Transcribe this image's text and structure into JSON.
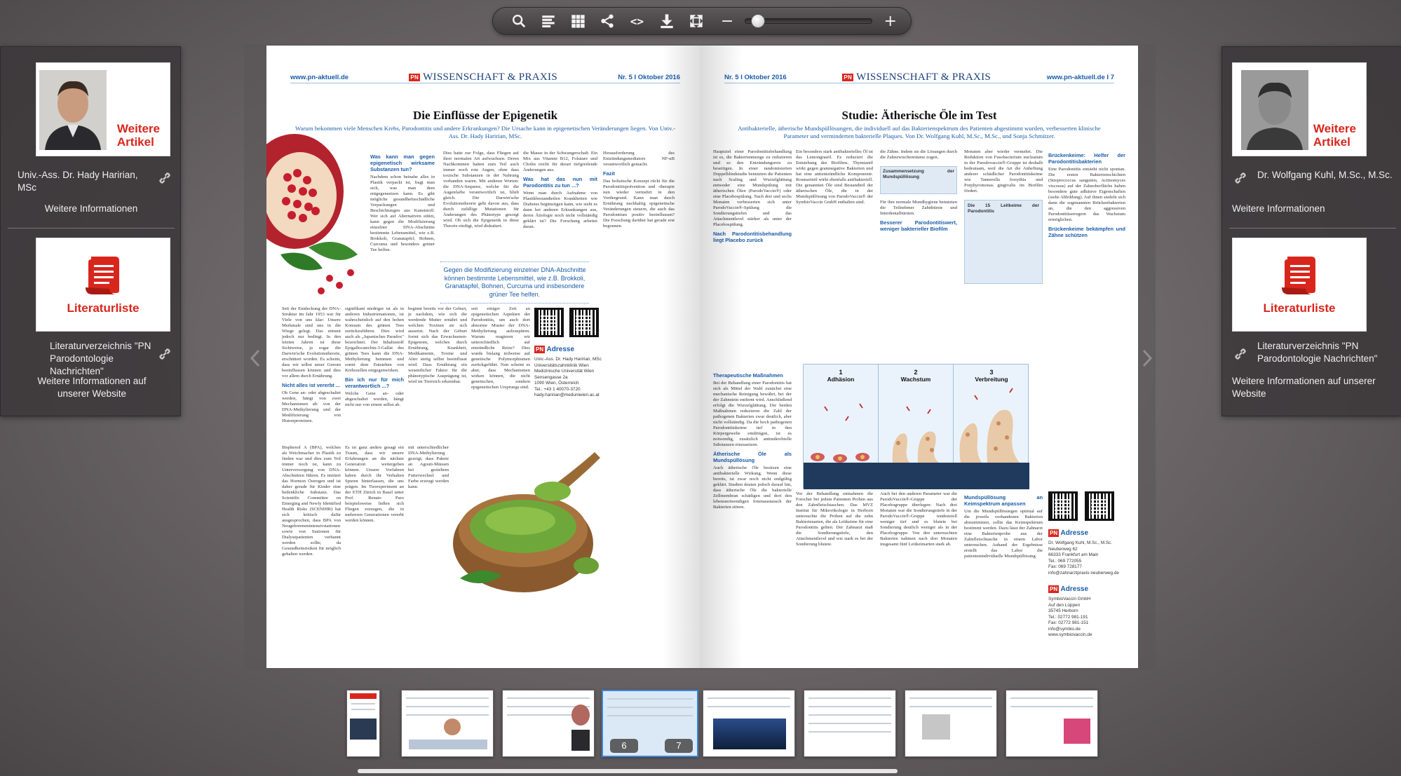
{
  "toolbar": {
    "icons": [
      "search-icon",
      "text-list-icon",
      "grid-icon",
      "share-icon",
      "code-icon",
      "download-icon",
      "fullscreen-icon"
    ],
    "code_glyph": "<>",
    "zoom_minus": "−",
    "zoom_plus": "+",
    "zoom_level": 0.05
  },
  "left_panel": {
    "author_card_label": "Weitere\nArtikel",
    "author_name": "Univ.-Ass. Dr. Hady Haririan, MSc",
    "author_more": "Weitere Informationen",
    "literature_label": "Literaturliste",
    "literature_name": "Literaturverzeichnis \"PN Parodontologie Nachrichten\"",
    "literature_more": "Weitere Informationen auf unserer Website"
  },
  "right_panel": {
    "author_card_label": "Weitere\nArtikel",
    "author_name": "Dr. Wolfgang Kuhl, M.Sc., M.Sc.",
    "author_more": "Weitere Informationen",
    "literature_label": "Literaturliste",
    "literature_name": "Literaturverzeichnis \"PN Parodontologie Nachrichten\"",
    "literature_more": "Weitere Informationen auf unserer Website"
  },
  "left_page": {
    "url": "www.pn-aktuell.de",
    "logo": "PN",
    "rubric": "WISSENSCHAFT & PRAXIS",
    "issue": "Nr. 5  I  Oktober 2016",
    "title": "Die Einflüsse der Epigenetik",
    "lead": "Warum bekommen viele Menschen Krebs, Parodontitis und andere Erkrankungen? Die Ursache kann in epigenetischen Veränderungen liegen. Von Univ.-Ass. Dr. Hady Haririan, MSc.",
    "h_q1": "Was kann man gegen epigenetisch wirksame Substanzen tun?",
    "h_q2": "Was hat das nun mit Parodontitis zu tun ...?",
    "h_fazit": "Fazit",
    "h_nicht_alles": "Nicht alles ist vererbt ...",
    "h_bin_ich": "Bin ich nur für mich verantwortlich ...?",
    "pull_quote": "Gegen die Modifizierung einzelner DNA-Abschnitte können bestimmte Lebensmittel, wie z.B. Brokkoli, Granatapfel, Bohnen, Curcuma und insbesondere grüner Tee helfen.",
    "adresse_label": "Adresse",
    "adresse_text": "Univ.-Ass. Dr. Hady Haririan, MSc\nUniversitätszahnklinik Wien\nMedizinische Universität Wien\nSensengasse 2a\n1090 Wien, Österreich\nTel.: +43 1 40070-3720\nhady.haririan@meduniwien.ac.at",
    "page_number": ""
  },
  "right_page": {
    "url": "www.pn-aktuell.de",
    "logo": "PN",
    "rubric": "WISSENSCHAFT & PRAXIS",
    "issue": "Nr. 5  I  Oktober 2016",
    "page_number": "7",
    "title": "Studie: Ätherische Öle im Test",
    "lead": "Antibakterielle, ätherische Mundspüllösungen, die individuell auf das Bakterienspektrum des Patienten abgestimmt wurden, verbesserten klinische Parameter und verminderten bakterielle Plaques. Von Dr. Wolfgang Kuhl, M.Sc., M.Sc., und Sonja Schmitzer.",
    "h_placebo": "Nach Parodontitisbehandlung liegt Placebo zurück",
    "h_besserer": "Besserer Parodontitiswert, weniger bakterieller Biofilm",
    "h_therapeutische": "Therapeutische Maßnahmen",
    "h_oele": "Ätherische Öle als Mundspüllösung",
    "h_mundspuel": "Mundspüllösung an Keimspektrum anpassen",
    "h_helfer": "Brückenkeime: Helfer der Parodontitisbakterien",
    "h_bekaempfen": "Brückenkeime bekämpfen und Zähne schützen",
    "info_title": "Die 15 Leitkeime der Parodontitis",
    "box_title": "Zusammensetzung der Mundspüllösung",
    "figure_labels": [
      {
        "num": "1",
        "label": "Adhäsion"
      },
      {
        "num": "2",
        "label": "Wachstum"
      },
      {
        "num": "3",
        "label": "Verbreitung"
      }
    ],
    "adresse_label": "Adresse",
    "adresse_text": "Dr. Wolfgang Kuhl, M.Sc., M.Sc.\nNeuberweg 62\n66333 Frankfurt am Main\nTel.: 069 772055\nFax: 069 728177\ninfo@zahnarztpraxis-neuberweg.de",
    "adresse2_text": "SymbioVaccin GmbH\nAuf den Lüppen\n35745 Herborn\nTel.: 02772 981-191\nFax: 02772 981-151\ninfo@symbio.de\nwww.symbiovaccin.de"
  },
  "thumbnails": {
    "active_pages": [
      "6",
      "7"
    ]
  },
  "colors": {
    "accent_red": "#d9261c",
    "accent_blue": "#1a5ca8",
    "active_thumb": "#3d86d6"
  }
}
